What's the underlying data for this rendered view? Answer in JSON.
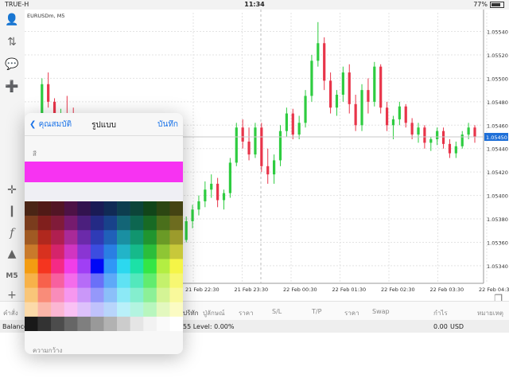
{
  "status_bar": {
    "carrier": "TRUE-H",
    "time": "11:34",
    "battery": "77%"
  },
  "chart": {
    "symbol_label": "EURUSDm, M5"
  },
  "chart_data": {
    "type": "candlestick",
    "title": "EURUSDm, M5",
    "ylim": [
      1.05325,
      1.05556
    ],
    "price_ticks": [
      "1.05540",
      "1.05520",
      "1.05500",
      "1.05480",
      "1.05460",
      "1.05440",
      "1.05420",
      "1.05400",
      "1.05380",
      "1.05360",
      "1.05340"
    ],
    "current_price": "1.05450",
    "time_ticks": [
      "21 Feb 22:30",
      "21 Feb 23:30",
      "22 Feb 00:30",
      "22 Feb 01:30",
      "22 Feb 02:30",
      "22 Feb 03:30",
      "22 Feb 04:30"
    ],
    "candles": [
      [
        1.05443,
        1.05455,
        1.0544,
        1.05452
      ],
      [
        1.05452,
        1.0547,
        1.05448,
        1.05465
      ],
      [
        1.05465,
        1.055,
        1.0546,
        1.05495
      ],
      [
        1.05495,
        1.05505,
        1.05475,
        1.0548
      ],
      [
        1.0548,
        1.05483,
        1.05455,
        1.0546
      ],
      [
        1.0546,
        1.05474,
        1.05452,
        1.05468
      ],
      [
        1.05468,
        1.05485,
        1.0546,
        1.05462
      ],
      [
        1.05462,
        1.05475,
        1.0544,
        1.05445
      ],
      [
        1.05445,
        1.05458,
        1.0544,
        1.05452
      ],
      [
        1.05452,
        1.0546,
        1.05445,
        1.05448
      ],
      [
        1.05448,
        1.05455,
        1.05438,
        1.0545
      ],
      [
        1.0545,
        1.05462,
        1.05445,
        1.05447
      ],
      [
        1.05447,
        1.05452,
        1.0543,
        1.05435
      ],
      [
        1.05435,
        1.05445,
        1.0542,
        1.05425
      ],
      [
        1.05425,
        1.0543,
        1.05395,
        1.054
      ],
      [
        1.054,
        1.05405,
        1.0536,
        1.05365
      ],
      [
        1.05365,
        1.05372,
        1.05345,
        1.0535
      ],
      [
        1.0535,
        1.0536,
        1.0534,
        1.05345
      ],
      [
        1.05345,
        1.05357,
        1.05335,
        1.05352
      ],
      [
        1.05352,
        1.05362,
        1.05342,
        1.05345
      ],
      [
        1.05345,
        1.05348,
        1.05332,
        1.05338
      ],
      [
        1.05338,
        1.05358,
        1.05332,
        1.05355
      ],
      [
        1.05355,
        1.05372,
        1.0535,
        1.05368
      ],
      [
        1.05368,
        1.05374,
        1.0535,
        1.05355
      ],
      [
        1.05355,
        1.05368,
        1.05348,
        1.05362
      ],
      [
        1.05362,
        1.05382,
        1.0536,
        1.05378
      ],
      [
        1.05378,
        1.05392,
        1.05372,
        1.05388
      ],
      [
        1.05388,
        1.054,
        1.05383,
        1.05395
      ],
      [
        1.05395,
        1.05412,
        1.0539,
        1.05405
      ],
      [
        1.05405,
        1.05418,
        1.05398,
        1.0541
      ],
      [
        1.0541,
        1.05415,
        1.0539,
        1.05396
      ],
      [
        1.05396,
        1.05405,
        1.05388,
        1.05402
      ],
      [
        1.05402,
        1.05432,
        1.05398,
        1.05428
      ],
      [
        1.05428,
        1.05462,
        1.05425,
        1.05458
      ],
      [
        1.05458,
        1.05465,
        1.0544,
        1.05446
      ],
      [
        1.05446,
        1.05458,
        1.0543,
        1.05435
      ],
      [
        1.05435,
        1.05462,
        1.05432,
        1.05458
      ],
      [
        1.05458,
        1.05462,
        1.0542,
        1.05425
      ],
      [
        1.05425,
        1.0544,
        1.0541,
        1.05418
      ],
      [
        1.05418,
        1.05435,
        1.0541,
        1.0543
      ],
      [
        1.0543,
        1.0546,
        1.05425,
        1.05455
      ],
      [
        1.05455,
        1.05475,
        1.0545,
        1.0547
      ],
      [
        1.0547,
        1.05474,
        1.05448,
        1.05452
      ],
      [
        1.05452,
        1.05468,
        1.05448,
        1.05462
      ],
      [
        1.05462,
        1.0549,
        1.05458,
        1.05485
      ],
      [
        1.05485,
        1.0552,
        1.0548,
        1.05515
      ],
      [
        1.05515,
        1.05548,
        1.0551,
        1.0553
      ],
      [
        1.0553,
        1.05535,
        1.0549,
        1.05498
      ],
      [
        1.05498,
        1.05505,
        1.0547,
        1.05475
      ],
      [
        1.05475,
        1.0549,
        1.05468,
        1.05486
      ],
      [
        1.05486,
        1.0551,
        1.0548,
        1.05505
      ],
      [
        1.05505,
        1.05512,
        1.0547,
        1.05478
      ],
      [
        1.05478,
        1.05486,
        1.05455,
        1.0546
      ],
      [
        1.0546,
        1.05495,
        1.05455,
        1.0549
      ],
      [
        1.0549,
        1.055,
        1.0547,
        1.0548
      ],
      [
        1.0548,
        1.05514,
        1.05476,
        1.0551
      ],
      [
        1.0551,
        1.05512,
        1.0547,
        1.05475
      ],
      [
        1.05475,
        1.0548,
        1.05455,
        1.0546
      ],
      [
        1.0546,
        1.05468,
        1.05448,
        1.05465
      ],
      [
        1.05465,
        1.0548,
        1.0546,
        1.05476
      ],
      [
        1.05476,
        1.05478,
        1.05458,
        1.05462
      ],
      [
        1.05462,
        1.05466,
        1.05448,
        1.05452
      ],
      [
        1.05452,
        1.05462,
        1.05445,
        1.05458
      ],
      [
        1.05458,
        1.0546,
        1.0544,
        1.05445
      ],
      [
        1.05445,
        1.0545,
        1.05438,
        1.05448
      ],
      [
        1.05448,
        1.05458,
        1.05443,
        1.05455
      ],
      [
        1.05455,
        1.05458,
        1.0544,
        1.05444
      ],
      [
        1.05444,
        1.05448,
        1.05432,
        1.05436
      ],
      [
        1.05436,
        1.05446,
        1.05432,
        1.05442
      ],
      [
        1.05442,
        1.05455,
        1.0544,
        1.05452
      ],
      [
        1.05452,
        1.05462,
        1.05448,
        1.05458
      ],
      [
        1.05458,
        1.0546,
        1.05445,
        1.0545
      ]
    ]
  },
  "popover": {
    "back_label": "คุณสมบัติ",
    "title": "รูปแบบ",
    "save_label": "บันทึก",
    "color_label": "สี",
    "selected_color": "#f733f2",
    "width_label": "ความกว้าง",
    "palette": [
      [
        "#4a2515",
        "#501a16",
        "#521525",
        "#4d1246",
        "#32134f",
        "#1a1b55",
        "#102a55",
        "#0d3d4f",
        "#0c4439",
        "#114519",
        "#2c4612",
        "#444313"
      ],
      [
        "#7a3c1d",
        "#801f1d",
        "#801b39",
        "#761b6e",
        "#4b1f7d",
        "#242a85",
        "#18428a",
        "#136576",
        "#0d6650",
        "#186a24",
        "#4a6f1b",
        "#6d6c1f"
      ],
      [
        "#a05a23",
        "#b0281e",
        "#b01f50",
        "#a92a98",
        "#6b2aaa",
        "#2f3bb6",
        "#2060b9",
        "#1a8fa2",
        "#11956f",
        "#20952f",
        "#6a9a26",
        "#9c9b2c"
      ],
      [
        "#c97a2b",
        "#d8311f",
        "#d5246b",
        "#d135c1",
        "#8a35d3",
        "#3c4de0",
        "#2a7fe3",
        "#22b4c8",
        "#16ba8b",
        "#2bbe3b",
        "#8ec634",
        "#c8c83a"
      ],
      [
        "#f39c12",
        "#f5351f",
        "#f52a86",
        "#f13ee8",
        "#a03ff5",
        "#0008f6",
        "#3096f7",
        "#2cd8ef",
        "#1ce1a7",
        "#34e646",
        "#b3ee42",
        "#f5f547"
      ],
      [
        "#f7b24a",
        "#f7614c",
        "#f7609f",
        "#f46ceb",
        "#b66cf7",
        "#6a70f8",
        "#5ea9f8",
        "#5fe2f3",
        "#53e8bc",
        "#61ec6f",
        "#c4f16c",
        "#f7f772"
      ],
      [
        "#f9c679",
        "#f98c79",
        "#f98cba",
        "#f697ef",
        "#ca97f9",
        "#9598fa",
        "#8bbff9",
        "#8ce9f6",
        "#84eece",
        "#8cf097",
        "#d4f495",
        "#f9f99b"
      ],
      [
        "#fbdaa9",
        "#fbb6a9",
        "#fbb6d3",
        "#f9c1f4",
        "#ddc1fb",
        "#c0c2fc",
        "#b8d5fb",
        "#b9f0f9",
        "#b3f4e0",
        "#b8f6be",
        "#e3f8bf",
        "#fbfbc3"
      ],
      [
        "#191919",
        "#333333",
        "#4c4c4c",
        "#666666",
        "#7f7f7f",
        "#999999",
        "#b2b2b2",
        "#cccccc",
        "#e5e5e5",
        "#f2f2f2",
        "#fafafa",
        "#ffffff"
      ]
    ]
  },
  "sidebar": {
    "timeframe": "M5"
  },
  "tabs": {
    "history_tab_partial": "ปร้ทัก"
  },
  "table": {
    "columns": [
      "คำสั่ง",
      "ปู่ลักษณ์",
      "ราคา",
      "S/L",
      "T/P",
      "ราคา",
      "Swap",
      "กำไร",
      "หมายเหตุ"
    ],
    "balance_label": "Balance",
    "level_text": "55 Level: 0.00%",
    "profit_value": "0.00",
    "currency": "USD"
  }
}
